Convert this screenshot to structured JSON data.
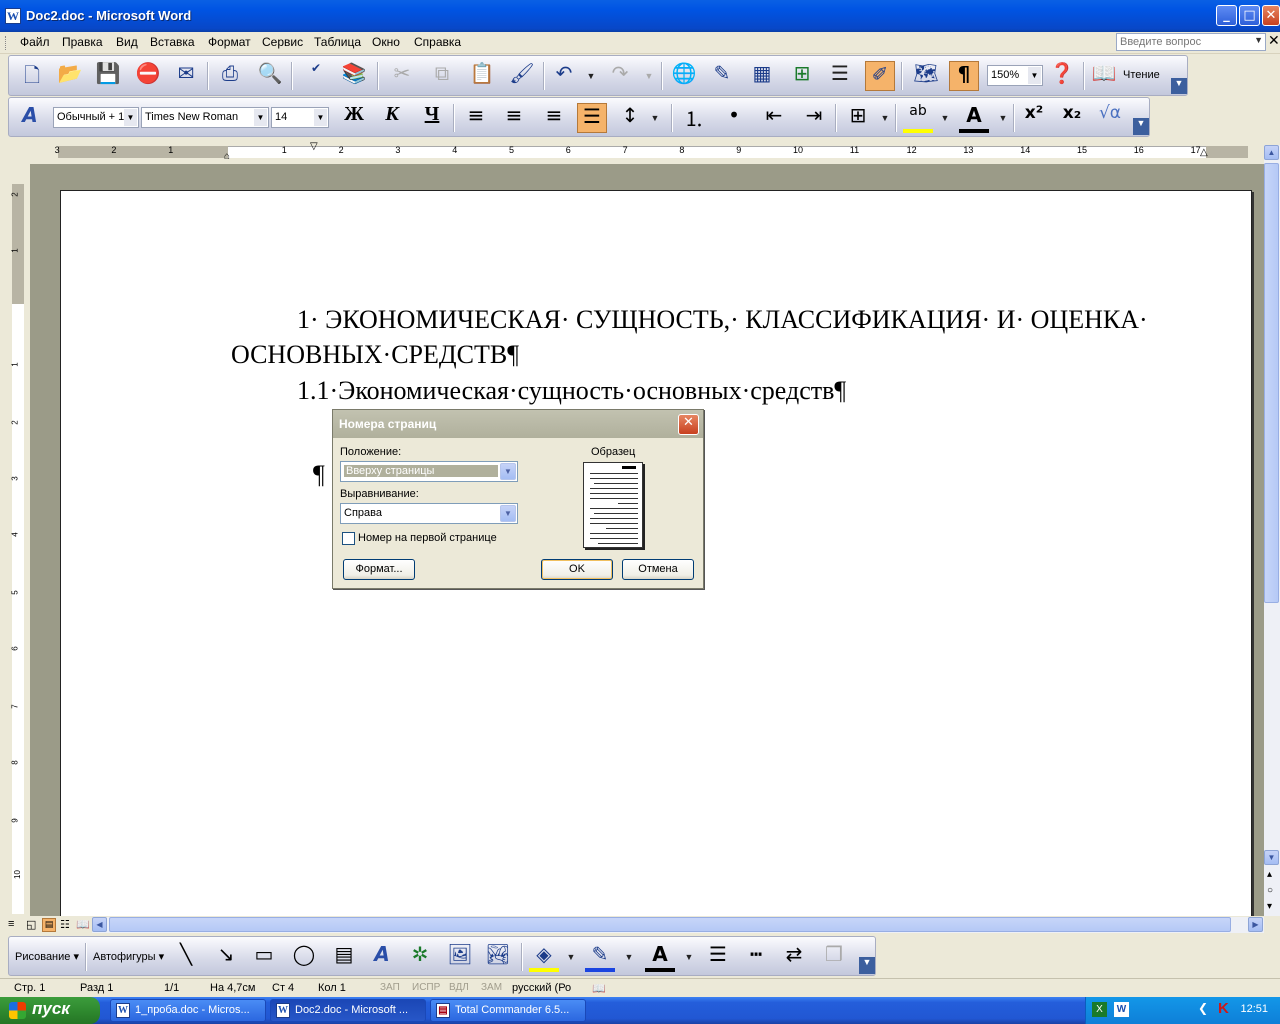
{
  "window": {
    "title": "Doc2.doc - Microsoft Word",
    "controls": {
      "minimize": "_",
      "maximize": "□",
      "close": "✕"
    }
  },
  "menu": {
    "items": [
      "Файл",
      "Правка",
      "Вид",
      "Вставка",
      "Формат",
      "Сервис",
      "Таблица",
      "Окно",
      "Справка"
    ],
    "ask_placeholder": "Введите вопрос"
  },
  "standard_toolbar": {
    "zoom": "150%",
    "reading_label": "Чтение",
    "icons": [
      "new-icon",
      "open-icon",
      "save-icon",
      "permission-icon",
      "email-icon",
      "print-icon",
      "print-preview-icon",
      "spelling-icon",
      "research-icon",
      "cut-icon",
      "copy-icon",
      "paste-icon",
      "format-painter-icon",
      "undo-icon",
      "redo-icon",
      "hyperlink-icon",
      "tables-borders-icon",
      "insert-table-icon",
      "insert-excel-icon",
      "columns-icon",
      "drawing-icon",
      "document-map-icon",
      "show-formatting-icon",
      "help-icon",
      "reading-layout-icon"
    ]
  },
  "formatting_toolbar": {
    "style": "Обычный + 1",
    "font": "Times New Roman",
    "size": "14",
    "bold": "Ж",
    "italic": "К",
    "underline": "Ч",
    "superscript": "x²",
    "subscript": "x₂",
    "formula": "√α"
  },
  "ruler": {
    "left_ticks": [
      "3",
      "2",
      "1"
    ],
    "ticks": [
      "1",
      "2",
      "3",
      "4",
      "5",
      "6",
      "7",
      "8",
      "9",
      "10",
      "11",
      "12",
      "13",
      "14",
      "15",
      "16",
      "17"
    ],
    "vertical_ticks": [
      "2",
      "1",
      "1",
      "2",
      "3",
      "4",
      "5",
      "6",
      "7",
      "8",
      "9",
      "10"
    ]
  },
  "document": {
    "heading1_line1": "1· ЭКОНОМИЧЕСКАЯ· СУЩНОСТЬ,· КЛАССИФИКАЦИЯ· И· ОЦЕНКА·",
    "heading1_line2": "ОСНОВНЫХ·СРЕДСТВ¶",
    "heading2": "1.1·Экономическая·сущность·основных·средств¶",
    "empty_paragraph": "¶"
  },
  "dialog": {
    "title": "Номера страниц",
    "position_label": "Положение:",
    "position_value": "Вверху страницы",
    "alignment_label": "Выравнивание:",
    "alignment_value": "Справа",
    "first_page_label": "Номер на первой странице",
    "first_page_checked": false,
    "preview_label": "Образец",
    "format_button": "Формат...",
    "ok_button": "OK",
    "cancel_button": "Отмена"
  },
  "drawing_toolbar": {
    "drawing": "Рисование",
    "autoshapes": "Автофигуры"
  },
  "status": {
    "page": "Стр.  1",
    "section": "Разд  1",
    "pages": "1/1",
    "at": "На  4,7см",
    "line": "Ст  4",
    "col": "Кол  1",
    "rec": "ЗАП",
    "trk": "ИСПР",
    "ext": "ВДЛ",
    "ovr": "ЗАМ",
    "language": "русский (Ро"
  },
  "taskbar": {
    "start": "пуск",
    "tasks": [
      "1_проба.doc - Micros...",
      "Doc2.doc - Microsoft ...",
      "Total Commander 6.5..."
    ],
    "clock": "12:51"
  },
  "colors": {
    "titlebar": "#0054e3",
    "accent_on": "#f5b36a",
    "taskbar": "#245edb",
    "start": "#2f8a2f"
  }
}
